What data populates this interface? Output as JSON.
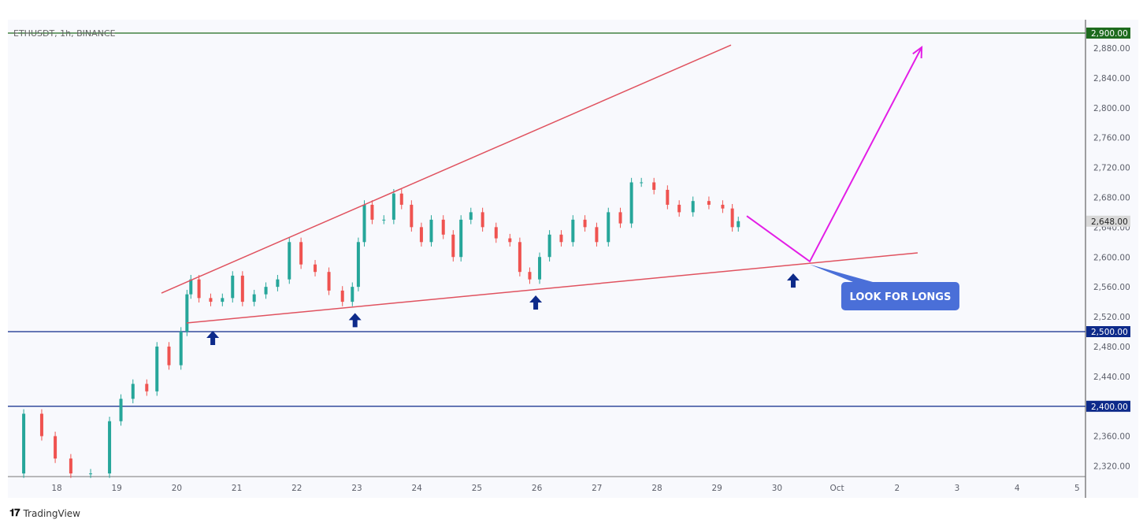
{
  "chart_data": {
    "type": "candlestick",
    "symbol_label": "ETHUSDT, 1h, BINANCE",
    "ylim": [
      2300,
      2925
    ],
    "y_ticks": [
      2320,
      2360,
      2400,
      2440,
      2480,
      2520,
      2560,
      2600,
      2640,
      2680,
      2720,
      2760,
      2800,
      2840,
      2880
    ],
    "x_ticks": [
      {
        "day": 18,
        "label": "18"
      },
      {
        "day": 19,
        "label": "19"
      },
      {
        "day": 20,
        "label": "20"
      },
      {
        "day": 21,
        "label": "21"
      },
      {
        "day": 22,
        "label": "22"
      },
      {
        "day": 23,
        "label": "23"
      },
      {
        "day": 24,
        "label": "24"
      },
      {
        "day": 25,
        "label": "25"
      },
      {
        "day": 26,
        "label": "26"
      },
      {
        "day": 27,
        "label": "27"
      },
      {
        "day": 28,
        "label": "28"
      },
      {
        "day": 29,
        "label": "29"
      },
      {
        "day": 30,
        "label": "30"
      },
      {
        "day": 31,
        "label": "Oct"
      },
      {
        "day": 32,
        "label": "2"
      },
      {
        "day": 33,
        "label": "3"
      },
      {
        "day": 34,
        "label": "4"
      },
      {
        "day": 35,
        "label": "5"
      }
    ],
    "xlim": [
      17.18,
      35.15
    ],
    "closes": [
      [
        17.25,
        2310
      ],
      [
        17.65,
        2390
      ],
      [
        17.85,
        2360
      ],
      [
        18.1,
        2330
      ],
      [
        18.37,
        2310
      ],
      [
        18.76,
        2310
      ],
      [
        19.0,
        2380
      ],
      [
        19.14,
        2410
      ],
      [
        19.4,
        2430
      ],
      [
        19.6,
        2420
      ],
      [
        19.74,
        2480
      ],
      [
        20.0,
        2455
      ],
      [
        20.14,
        2500
      ],
      [
        20.2,
        2550
      ],
      [
        20.27,
        2570
      ],
      [
        20.47,
        2545
      ],
      [
        20.66,
        2540
      ],
      [
        20.86,
        2545
      ],
      [
        21.0,
        2575
      ],
      [
        21.19,
        2540
      ],
      [
        21.39,
        2550
      ],
      [
        21.58,
        2560
      ],
      [
        21.78,
        2570
      ],
      [
        21.97,
        2620
      ],
      [
        22.17,
        2590
      ],
      [
        22.44,
        2580
      ],
      [
        22.63,
        2555
      ],
      [
        22.89,
        2540
      ],
      [
        22.96,
        2560
      ],
      [
        23.09,
        2620
      ],
      [
        23.16,
        2670
      ],
      [
        23.35,
        2650
      ],
      [
        23.55,
        2650
      ],
      [
        23.68,
        2685
      ],
      [
        23.81,
        2670
      ],
      [
        24.01,
        2640
      ],
      [
        24.14,
        2620
      ],
      [
        24.34,
        2650
      ],
      [
        24.54,
        2630
      ],
      [
        24.67,
        2600
      ],
      [
        24.8,
        2650
      ],
      [
        25.0,
        2660
      ],
      [
        25.19,
        2640
      ],
      [
        25.45,
        2625
      ],
      [
        25.65,
        2620
      ],
      [
        25.78,
        2580
      ],
      [
        25.98,
        2570
      ],
      [
        26.11,
        2600
      ],
      [
        26.31,
        2630
      ],
      [
        26.5,
        2620
      ],
      [
        26.7,
        2650
      ],
      [
        26.9,
        2640
      ],
      [
        27.09,
        2620
      ],
      [
        27.29,
        2660
      ],
      [
        27.49,
        2645
      ],
      [
        27.66,
        2700
      ],
      [
        27.82,
        2700
      ],
      [
        28.08,
        2690
      ],
      [
        28.27,
        2670
      ],
      [
        28.47,
        2660
      ],
      [
        28.73,
        2675
      ],
      [
        29.0,
        2670
      ],
      [
        29.19,
        2665
      ],
      [
        29.32,
        2640
      ],
      [
        29.39,
        2648
      ]
    ],
    "current_price": {
      "value": 2648,
      "label": "2,648.00"
    },
    "horizontal_levels": [
      {
        "value": 2900,
        "label": "2,900.00",
        "color": "#1e6b1e"
      },
      {
        "value": 2500,
        "label": "2,500.00",
        "color": "#0d2a8a"
      },
      {
        "value": 2400,
        "label": "2,400.00",
        "color": "#0d2a8a"
      }
    ],
    "trendlines": [
      {
        "from": [
          19.745,
          2551.7
        ],
        "to": [
          29.234,
          2884
        ],
        "color": "#e0525f"
      },
      {
        "from": [
          20.165,
          2511.6
        ],
        "to": [
          32.343,
          2605.5
        ],
        "color": "#e0525f"
      }
    ],
    "projection_path": {
      "points": [
        [
          29.496,
          2655
        ],
        [
          30.546,
          2594
        ],
        [
          32.41,
          2881
        ]
      ],
      "color": "#e31ee6"
    },
    "support_arrows": [
      [
        20.6,
        2501
      ],
      [
        22.97,
        2525
      ],
      [
        25.98,
        2548.5
      ],
      [
        30.27,
        2578
      ]
    ],
    "arrow_color": "#0d2a8a",
    "callout": {
      "text": "LOOK FOR LONGS",
      "anchor": [
        30.546,
        2590
      ],
      "box_at": [
        31.07,
        2547.5
      ],
      "color": "#4a6fd8"
    },
    "colors": {
      "up": "#26a69a",
      "down": "#ef5350"
    }
  },
  "footer": {
    "brand": "TradingView",
    "logo": "TV"
  }
}
